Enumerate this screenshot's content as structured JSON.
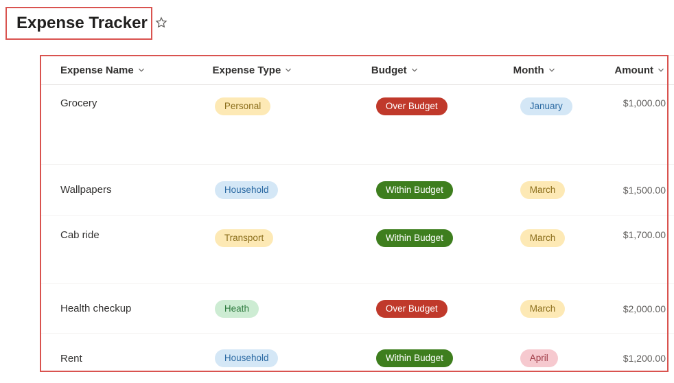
{
  "page_title": "Expense Tracker",
  "columns": {
    "name": "Expense Name",
    "type": "Expense Type",
    "budget": "Budget",
    "month": "Month",
    "amount": "Amount"
  },
  "type_styles": {
    "Personal": "pill-yellow",
    "Household": "pill-blue",
    "Transport": "pill-yellow",
    "Heath": "pill-lightgreen"
  },
  "budget_styles": {
    "Over Budget": "pill-red",
    "Within Budget": "pill-green"
  },
  "month_styles": {
    "January": "pill-blue",
    "March": "pill-yellow",
    "April": "pill-pink"
  },
  "rows": [
    {
      "name": "Grocery",
      "type": "Personal",
      "budget": "Over Budget",
      "month": "January",
      "amount": "$1,000.00",
      "height": "h-tall"
    },
    {
      "name": "Wallpapers",
      "type": "Household",
      "budget": "Within Budget",
      "month": "March",
      "amount": "$1,500.00",
      "height": "h-med"
    },
    {
      "name": "Cab ride",
      "type": "Transport",
      "budget": "Within Budget",
      "month": "March",
      "amount": "$1,700.00",
      "height": "h-tall2"
    },
    {
      "name": "Health checkup",
      "type": "Heath",
      "budget": "Over Budget",
      "month": "March",
      "amount": "$2,000.00",
      "height": "h-short"
    },
    {
      "name": "Rent",
      "type": "Household",
      "budget": "Within Budget",
      "month": "April",
      "amount": "$1,200.00",
      "height": "h-last"
    }
  ]
}
